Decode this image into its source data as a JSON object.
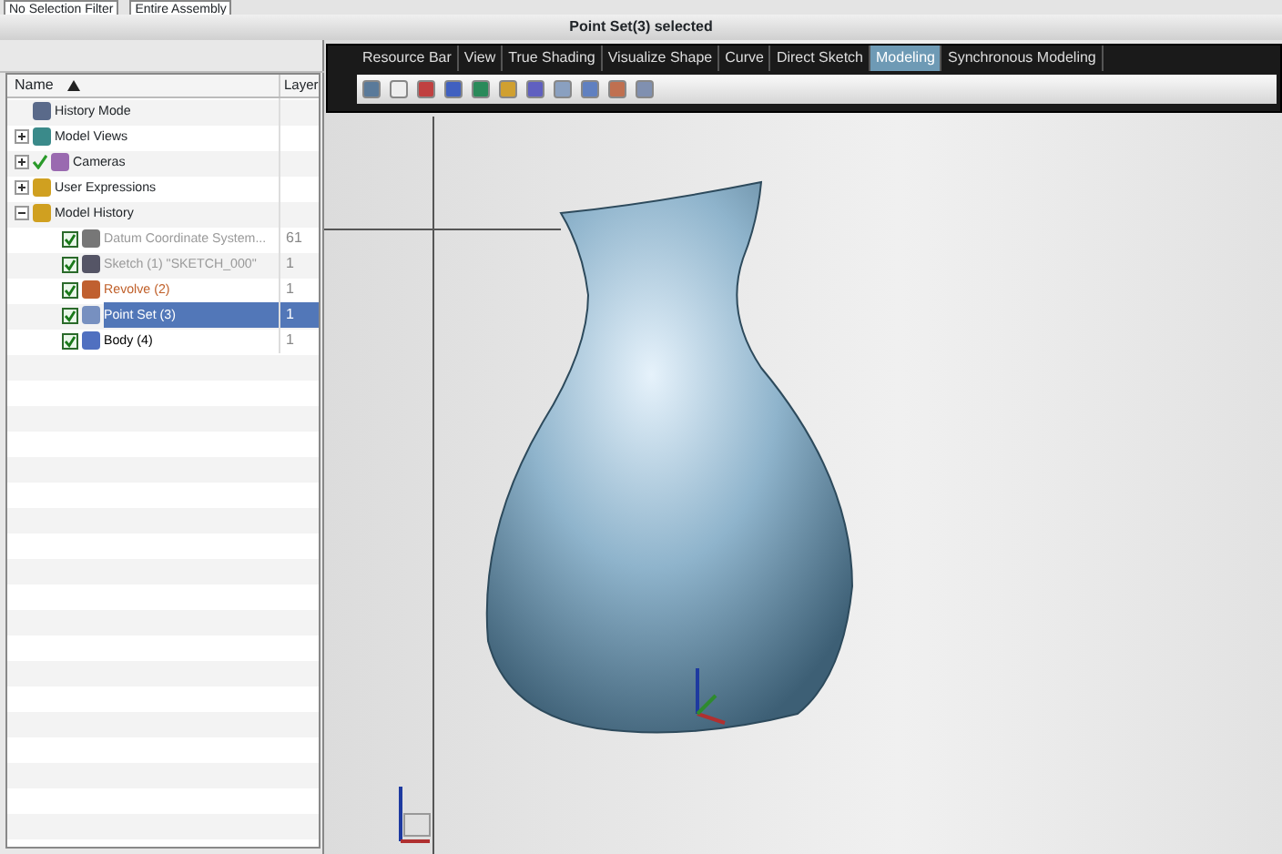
{
  "top_toolbar": {
    "selection_filter": "No Selection Filter",
    "scope": "Entire Assembly"
  },
  "title_bar": {
    "title": "Point Set(3) selected"
  },
  "navigator": {
    "columns": [
      "Name",
      "Layer"
    ],
    "items": [
      {
        "label": "History Mode"
      },
      {
        "label": "Model Views",
        "expanded": false
      },
      {
        "label": "Cameras",
        "expanded": false,
        "checked": true
      },
      {
        "label": "User Expressions",
        "expanded": false
      },
      {
        "label": "Model History",
        "expanded": true,
        "children": [
          {
            "label": "Datum Coordinate System...",
            "checked": true,
            "kind": "greyed",
            "layer": "61",
            "selected": false
          },
          {
            "label": "Sketch (1) \"SKETCH_000\"",
            "checked": true,
            "kind": "greyed",
            "layer": "1",
            "selected": false
          },
          {
            "label": "Revolve (2)",
            "checked": true,
            "kind": "parent",
            "layer": "1",
            "selected": false
          },
          {
            "label": "Point Set (3)",
            "checked": true,
            "kind": "normal",
            "layer": "1",
            "selected": true
          },
          {
            "label": "Body (4)",
            "checked": true,
            "kind": "normal",
            "layer": "1",
            "selected": false
          }
        ]
      }
    ]
  },
  "ribbon": {
    "tabs": [
      {
        "label": "Resource Bar",
        "selected": false
      },
      {
        "label": "View",
        "selected": false
      },
      {
        "label": "True Shading",
        "selected": false
      },
      {
        "label": "Visualize Shape",
        "selected": false
      },
      {
        "label": "Curve",
        "selected": false
      },
      {
        "label": "Direct Sketch",
        "selected": false
      },
      {
        "label": "Modeling",
        "selected": true
      },
      {
        "label": "Synchronous Modeling",
        "selected": false
      }
    ]
  }
}
